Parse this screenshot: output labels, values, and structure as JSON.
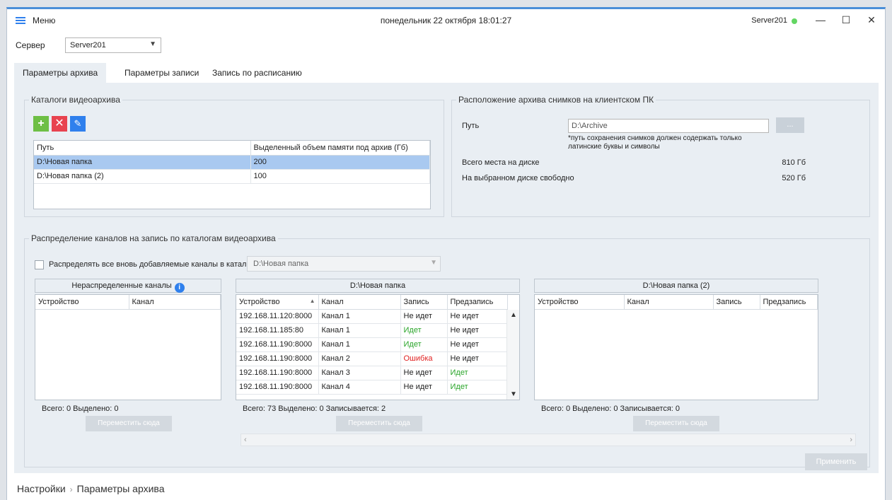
{
  "window": {
    "menu_label": "Меню",
    "datetime": "понедельник 22 октября 18:01:27",
    "server_name": "Server201",
    "status_color": "#63d663",
    "minimize": "—",
    "maximize": "☐",
    "close": "✕"
  },
  "server_row": {
    "label": "Сервер",
    "value": "Server201"
  },
  "tabs": [
    {
      "label": "Параметры архива",
      "active": true
    },
    {
      "label": "Параметры записи",
      "active": false
    },
    {
      "label": "Запись по расписанию",
      "active": false
    }
  ],
  "catalogs": {
    "legend": "Каталоги видеоархива",
    "toolbar": {
      "add": "+",
      "delete": "✕",
      "edit": "✎"
    },
    "columns": [
      "Путь",
      "Выделенный объем памяти под архив (Гб)"
    ],
    "rows": [
      {
        "path": "D:\\Новая папка",
        "size": "200",
        "selected": true
      },
      {
        "path": "D:\\Новая папка (2)",
        "size": "100",
        "selected": false
      }
    ]
  },
  "snapshot": {
    "legend": "Расположение архива снимков на клиентском ПК",
    "path_label": "Путь",
    "path_value": "D:\\Archive",
    "browse_label": "...",
    "note": "*путь сохранения снимков должен содержать только латинские буквы и символы",
    "total_label": "Всего места на диске",
    "total_value": "810 Гб",
    "free_label": "На выбранном диске свободно",
    "free_value": "520 Гб"
  },
  "distribution": {
    "legend": "Распределение каналов на запись по каталогам видеоархива",
    "auto_assign_label": "Распределять все вновь добавляемые каналы в каталог",
    "auto_assign_catalog": "D:\\Новая папка",
    "unassigned": {
      "title": "Нераспределенные каналы",
      "columns": [
        "Устройство",
        "Канал"
      ],
      "counts": "Всего: 0 Выделено: 0",
      "move_label": "Переместить сюда"
    },
    "catalog1": {
      "title": "D:\\Новая папка",
      "columns": [
        "Устройство",
        "Канал",
        "Запись",
        "Предзапись"
      ],
      "rows": [
        {
          "device": "192.168.11.120:8000",
          "channel": "Канал 1",
          "rec": "Не идет",
          "prerec": "Не идет"
        },
        {
          "device": "192.168.11.185:80",
          "channel": "Канал 1",
          "rec": "Идет",
          "prerec": "Не идет"
        },
        {
          "device": "192.168.11.190:8000",
          "channel": "Канал 1",
          "rec": "Идет",
          "prerec": "Не идет"
        },
        {
          "device": "192.168.11.190:8000",
          "channel": "Канал 2",
          "rec": "Ошибка",
          "prerec": "Не идет"
        },
        {
          "device": "192.168.11.190:8000",
          "channel": "Канал 3",
          "rec": "Не идет",
          "prerec": "Идет"
        },
        {
          "device": "192.168.11.190:8000",
          "channel": "Канал 4",
          "rec": "Не идет",
          "prerec": "Идет"
        }
      ],
      "counts": "Всего: 73 Выделено: 0 Записывается: 2",
      "move_label": "Переместить сюда"
    },
    "catalog2": {
      "title": "D:\\Новая папка (2)",
      "columns": [
        "Устройство",
        "Канал",
        "Запись",
        "Предзапись"
      ],
      "counts": "Всего: 0 Выделено: 0 Записывается: 0",
      "move_label": "Переместить сюда"
    },
    "apply_label": "Применить"
  },
  "breadcrumb": {
    "root": "Настройки",
    "current": "Параметры архива"
  }
}
